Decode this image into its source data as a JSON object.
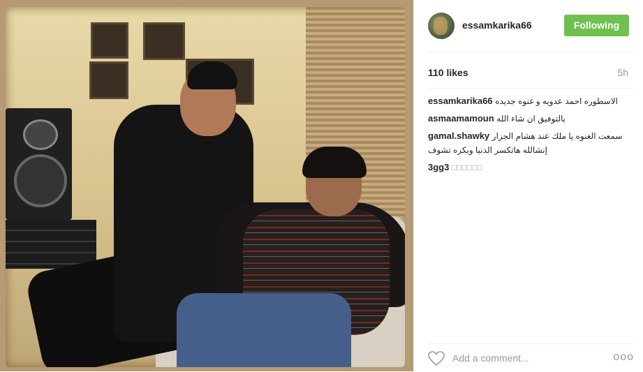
{
  "post": {
    "username": "essamkarika66",
    "follow_label": "Following",
    "likes": "110 likes",
    "time_ago": "5h",
    "comments": [
      {
        "user": "essamkarika66",
        "text": "الاسطوره احمد عدويه و غنوه جديده"
      },
      {
        "user": "asmaamamoun",
        "text": "بالتوفيق ان شاء الله"
      },
      {
        "user": "gamal.shawky",
        "text": "سمعت الغنوه يا ملك عند هشام الجزار إنشالله هاتكسر الدنيا وبكره تشوف"
      },
      {
        "user": "3gg3",
        "text": "□□□□□□"
      }
    ],
    "add_comment_placeholder": "Add a comment...",
    "more_label": "ooo"
  },
  "icons": {
    "like": "heart-icon",
    "options": "more-options-icon"
  },
  "colors": {
    "follow_button": "#70c050",
    "muted_text": "#999999"
  }
}
